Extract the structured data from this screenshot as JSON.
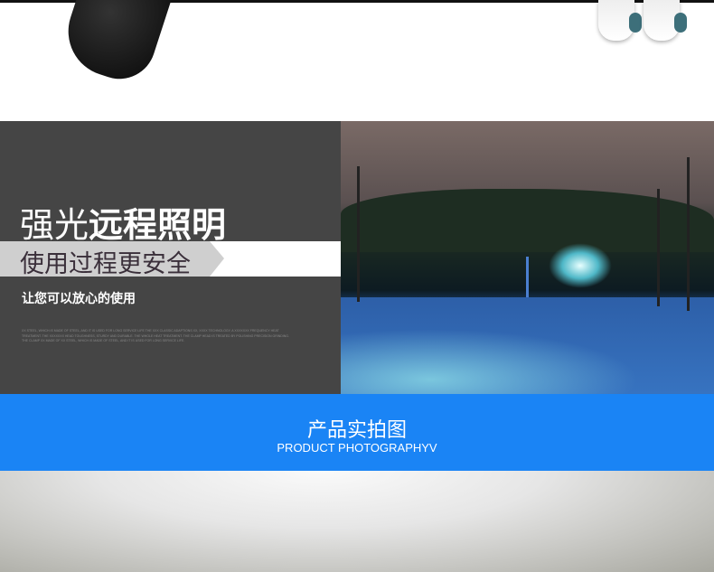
{
  "feature": {
    "title_light": "强光",
    "title_bold": "远程照明",
    "subtitle": "使用过程更安全",
    "lead": "让您可以放心的使用",
    "fine_print": "XX STEEL, WHICH IS MADE OF STEEL, AND IT IS USED FOR LONG SERVICE LIFE THE XXX CLASSIC ADAPTIONS XX, XXXX TECHNOLOGY, A XXXXXXX FREQUENCY HEAT TREATMENT. THE XXXXXXX HEAD TOUGHNESS, STURDY AND DURABLE. THE WHOLE HEAT TREATMENT. THE CLAMP HEAD IS TREATED BY POLISHING PRECISION GRINDING. THE CLAMP XX MADE OF XX STEEL, WHICH IS MADE OF STEEL, AND IT IS USED FOR LONG SERVICE LIFE."
  },
  "section_header": {
    "title": "产品实拍图",
    "subtitle": "PRODUCT PHOTOGRAPHYV",
    "color": "#1a84f5"
  }
}
